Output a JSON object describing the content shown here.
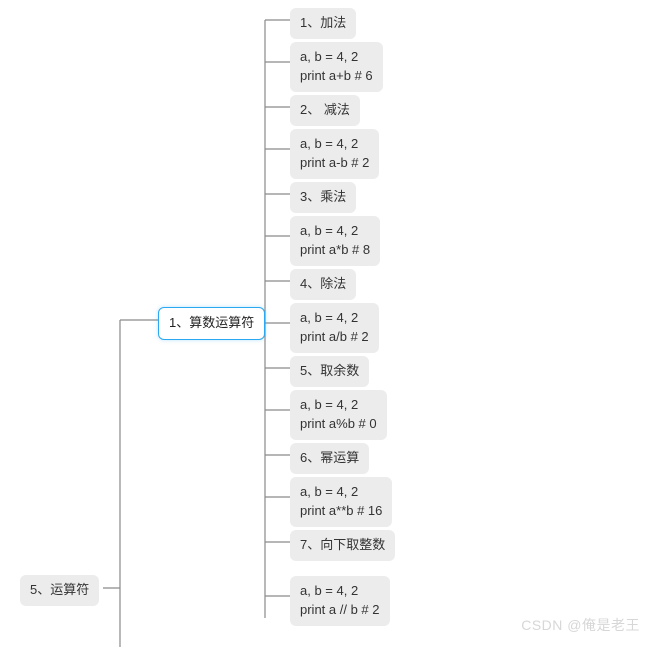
{
  "root": {
    "label": "5、运算符"
  },
  "branch1": {
    "label": "1、算数运算符"
  },
  "leaves": {
    "n1_title": "1、加法",
    "n1_code": "a, b = 4, 2\nprint a+b # 6",
    "n2_title": "2、 减法",
    "n2_code": "a, b = 4, 2\nprint a-b # 2",
    "n3_title": "3、乘法",
    "n3_code": "a, b = 4, 2\nprint a*b # 8",
    "n4_title": "4、除法",
    "n4_code": "a, b = 4, 2\nprint a/b # 2",
    "n5_title": "5、取余数",
    "n5_code": "a, b = 4, 2\nprint a%b # 0",
    "n6_title": "6、幂运算",
    "n6_code": "a, b = 4, 2\nprint a**b # 16",
    "n7_title": "7、向下取整数",
    "n7_code": "a, b = 4, 2\nprint a // b # 2"
  },
  "watermark": "CSDN @俺是老王"
}
